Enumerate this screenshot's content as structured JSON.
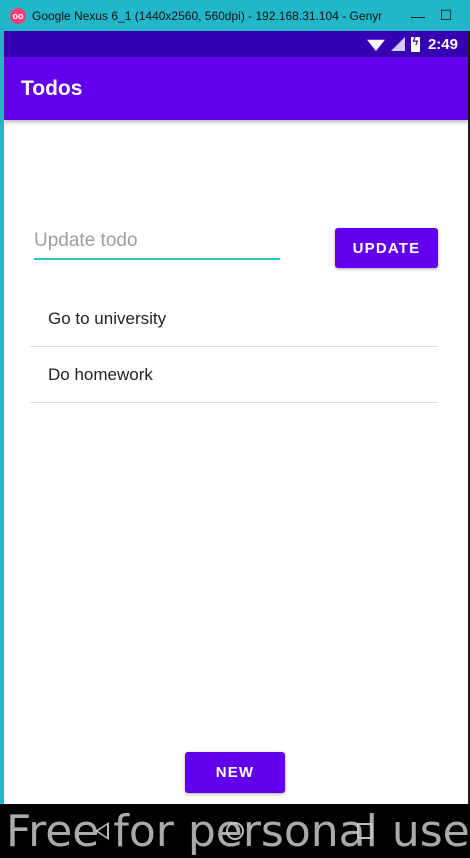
{
  "window": {
    "title": "Google Nexus 6_1 (1440x2560, 560dpi) - 192.168.31.104 - Genym...",
    "minimize_icon": "minimize-icon",
    "maximize_icon": "maximize-icon"
  },
  "status_bar": {
    "time": "2:49",
    "icons": [
      "wifi-icon",
      "signal-icon",
      "battery-charging-icon"
    ]
  },
  "toolbar": {
    "title": "Todos",
    "color": "#6200ee"
  },
  "editor": {
    "input_value": "",
    "input_placeholder": "Update todo",
    "update_label": "UPDATE"
  },
  "todos": [
    {
      "text": "Go to university"
    },
    {
      "text": "Do homework"
    }
  ],
  "actions": {
    "new_label": "NEW"
  },
  "nav_bar": {
    "icons": [
      "back-icon",
      "home-icon",
      "recents-icon"
    ]
  },
  "watermark": "Free for personal use",
  "colors": {
    "primary": "#6200ee",
    "primary_dark": "#3700b3",
    "accent_underline": "#26c6c9",
    "window_frame": "#21b7c9"
  }
}
